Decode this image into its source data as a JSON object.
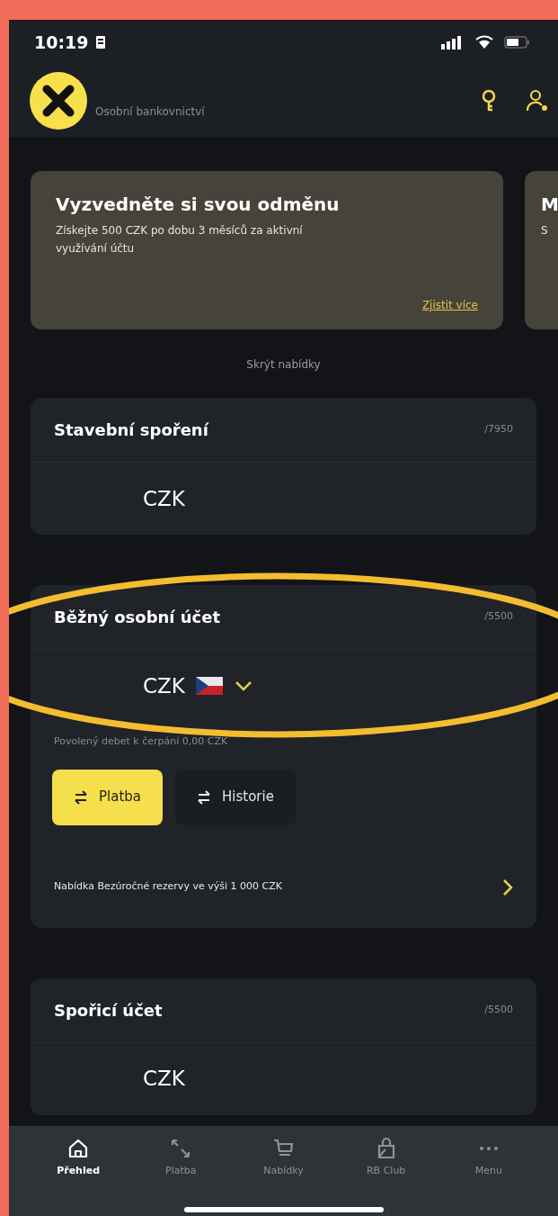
{
  "status_bar": {
    "time": "10:19"
  },
  "header": {
    "subtitle": "Osobní bankovnictví"
  },
  "offers": [
    {
      "title": "Vyzvedněte si svou odměnu",
      "text": "Získejte 500 CZK po dobu 3 měsíců za aktivní využívání účtu",
      "link": "Zjistit více"
    },
    {
      "title": "M",
      "text": "S"
    }
  ],
  "hide_offers": "Skrýt nabídky",
  "accounts": [
    {
      "name": "Stavební spoření",
      "number": "/7950",
      "currency": "CZK",
      "flag": false
    },
    {
      "name": "Běžný osobní účet",
      "number": "/5500",
      "currency": "CZK",
      "flag": true,
      "highlighted": true,
      "note": "Povolený debet k čerpání 0,00 CZK",
      "actions": [
        {
          "label": "Platba",
          "selected": true
        },
        {
          "label": "Historie",
          "selected": false
        }
      ],
      "offer": "Nabídka Bezúročné rezervy ve výši 1 000 CZK"
    },
    {
      "name": "Spořicí účet",
      "number": "/5500",
      "currency": "CZK",
      "flag": false
    }
  ],
  "nav": [
    {
      "label": "Přehled",
      "kind": "home",
      "selected": true
    },
    {
      "label": "Platba",
      "kind": "arrows",
      "selected": false
    },
    {
      "label": "Nabídky",
      "kind": "cart",
      "selected": false
    },
    {
      "label": "RB Club",
      "kind": "bag",
      "selected": false
    },
    {
      "label": "Menu",
      "kind": "dots",
      "selected": false
    }
  ]
}
